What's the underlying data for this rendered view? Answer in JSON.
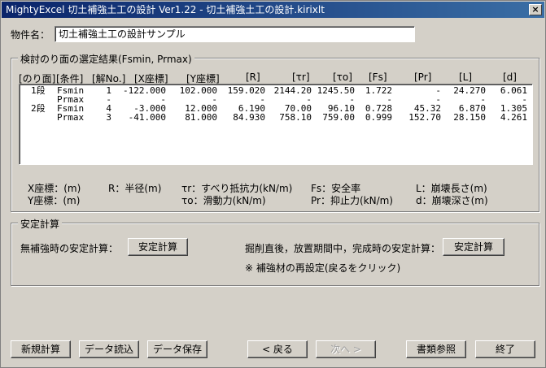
{
  "window": {
    "title": "MightyExcel 切土補強土工の設計 Ver1.22 - 切土補強土工の設計.kirixlt",
    "close": "×"
  },
  "property": {
    "label": "物件名：",
    "value": "切土補強土工の設計サンプル"
  },
  "results": {
    "group_title": "検討のり面の選定結果(Fsmin, Prmax)",
    "headers": [
      "[のり面]",
      "[条件]",
      "[解No.]",
      "[X座標]",
      "[Y座標]",
      "[R]",
      "[τr]",
      "[τo]",
      "[Fs]",
      "[Pr]",
      "[L]",
      "[d]"
    ],
    "rows": [
      [
        "1段",
        "Fsmin",
        "1",
        "-122.000",
        "102.000",
        "159.020",
        "2144.20",
        "1245.50",
        "1.722",
        "-",
        "24.270",
        "6.061"
      ],
      [
        "",
        "Prmax",
        "-",
        "-",
        "-",
        "-",
        "-",
        "-",
        "-",
        "-",
        "-",
        "-"
      ],
      [
        "2段",
        "Fsmin",
        "4",
        "-3.000",
        "12.000",
        "6.190",
        "70.00",
        "96.10",
        "0.728",
        "45.32",
        "6.870",
        "1.305"
      ],
      [
        "",
        "Prmax",
        "3",
        "-41.000",
        "81.000",
        "84.930",
        "758.10",
        "759.00",
        "0.999",
        "152.70",
        "28.150",
        "4.261"
      ]
    ],
    "legend": {
      "x": "X座標：(m)",
      "y": "Y座標：(m)",
      "r": "R：半径(m)",
      "tr": "τr：すべり抵抗力(kN/m)",
      "to": "τo：滑動力(kN/m)",
      "fs": "Fs：安全率",
      "pr": "Pr：抑止力(kN/m)",
      "l": "L：崩壊長さ(m)",
      "d": "d：崩壊深さ(m)"
    }
  },
  "stability": {
    "group_title": "安定計算",
    "unreinforced_label": "無補強時の安定計算：",
    "unreinforced_button": "安定計算",
    "after_excavation_label": "掘削直後，放置期間中，完成時の安定計算：",
    "after_excavation_button": "安定計算",
    "note": "※ 補強材の再設定(戻るをクリック)"
  },
  "footer": {
    "new_calc": "新規計算",
    "load_data": "データ読込",
    "save_data": "データ保存",
    "back": "< 戻る",
    "next": "次へ >",
    "reference": "書類参照",
    "exit": "終了"
  }
}
